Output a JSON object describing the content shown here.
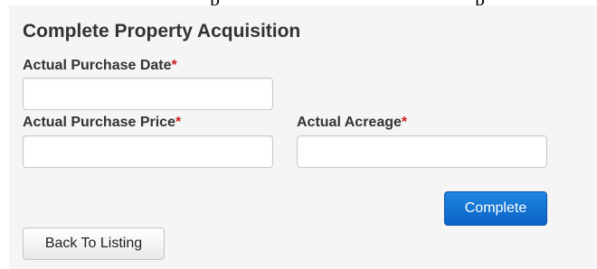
{
  "form": {
    "title": "Complete Property Acquisition",
    "required_marker": "*",
    "fields": {
      "purchase_date": {
        "label": "Actual Purchase Date",
        "value": ""
      },
      "purchase_price": {
        "label": "Actual Purchase Price",
        "value": ""
      },
      "acreage": {
        "label": "Actual Acreage",
        "value": ""
      }
    },
    "complete_button": "Complete",
    "back_button": "Back To Listing"
  },
  "colors": {
    "panel_background": "#f5f5f5",
    "text": "#333333",
    "required": "#cc2222",
    "primary_button": "#0a63c4"
  }
}
